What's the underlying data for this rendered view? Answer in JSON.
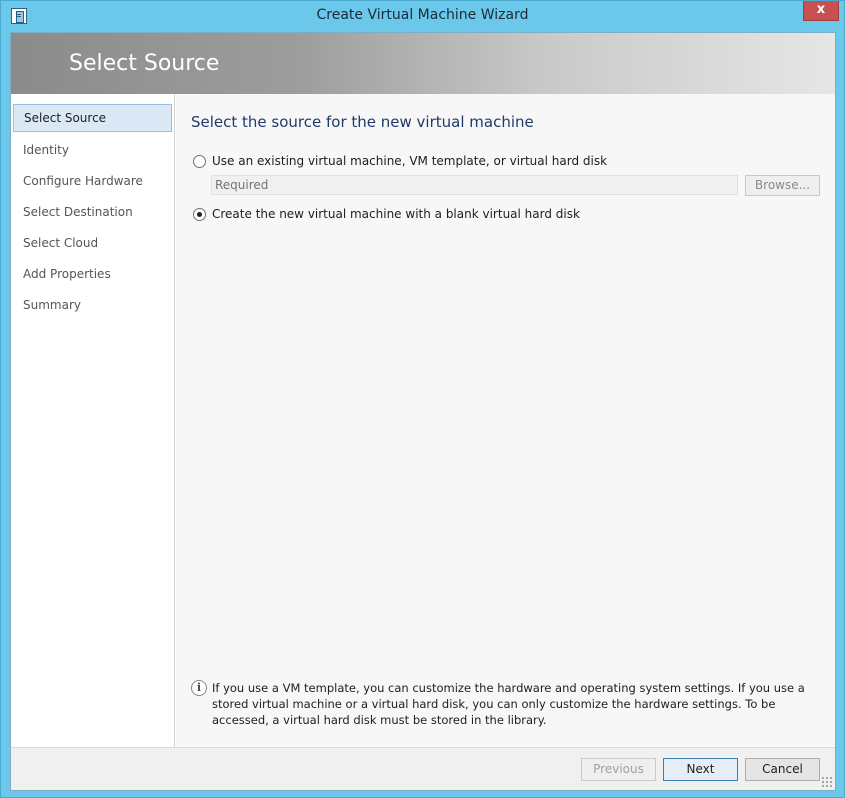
{
  "window": {
    "title": "Create Virtual Machine Wizard",
    "close_label": "x",
    "accent_color": "#6bc8ea"
  },
  "banner": {
    "title": "Select Source"
  },
  "sidebar": {
    "items": [
      {
        "label": "Select Source",
        "active": true
      },
      {
        "label": "Identity",
        "active": false
      },
      {
        "label": "Configure Hardware",
        "active": false
      },
      {
        "label": "Select Destination",
        "active": false
      },
      {
        "label": "Select Cloud",
        "active": false
      },
      {
        "label": "Add Properties",
        "active": false
      },
      {
        "label": "Summary",
        "active": false
      }
    ]
  },
  "main": {
    "heading": "Select the source for the new virtual machine",
    "option_existing": {
      "label": "Use an existing virtual machine, VM template, or virtual hard disk",
      "selected": false
    },
    "path_field": {
      "placeholder": "Required",
      "value": ""
    },
    "browse_label": "Browse...",
    "option_blank": {
      "label": "Create the new virtual machine with a blank virtual hard disk",
      "selected": true
    },
    "info_text": "If you use a VM template, you can customize the hardware and operating system settings. If you use a stored virtual machine or a virtual hard disk, you can only customize the hardware settings. To be accessed, a virtual hard disk must be stored in the library."
  },
  "footer": {
    "previous_label": "Previous",
    "next_label": "Next",
    "cancel_label": "Cancel"
  }
}
